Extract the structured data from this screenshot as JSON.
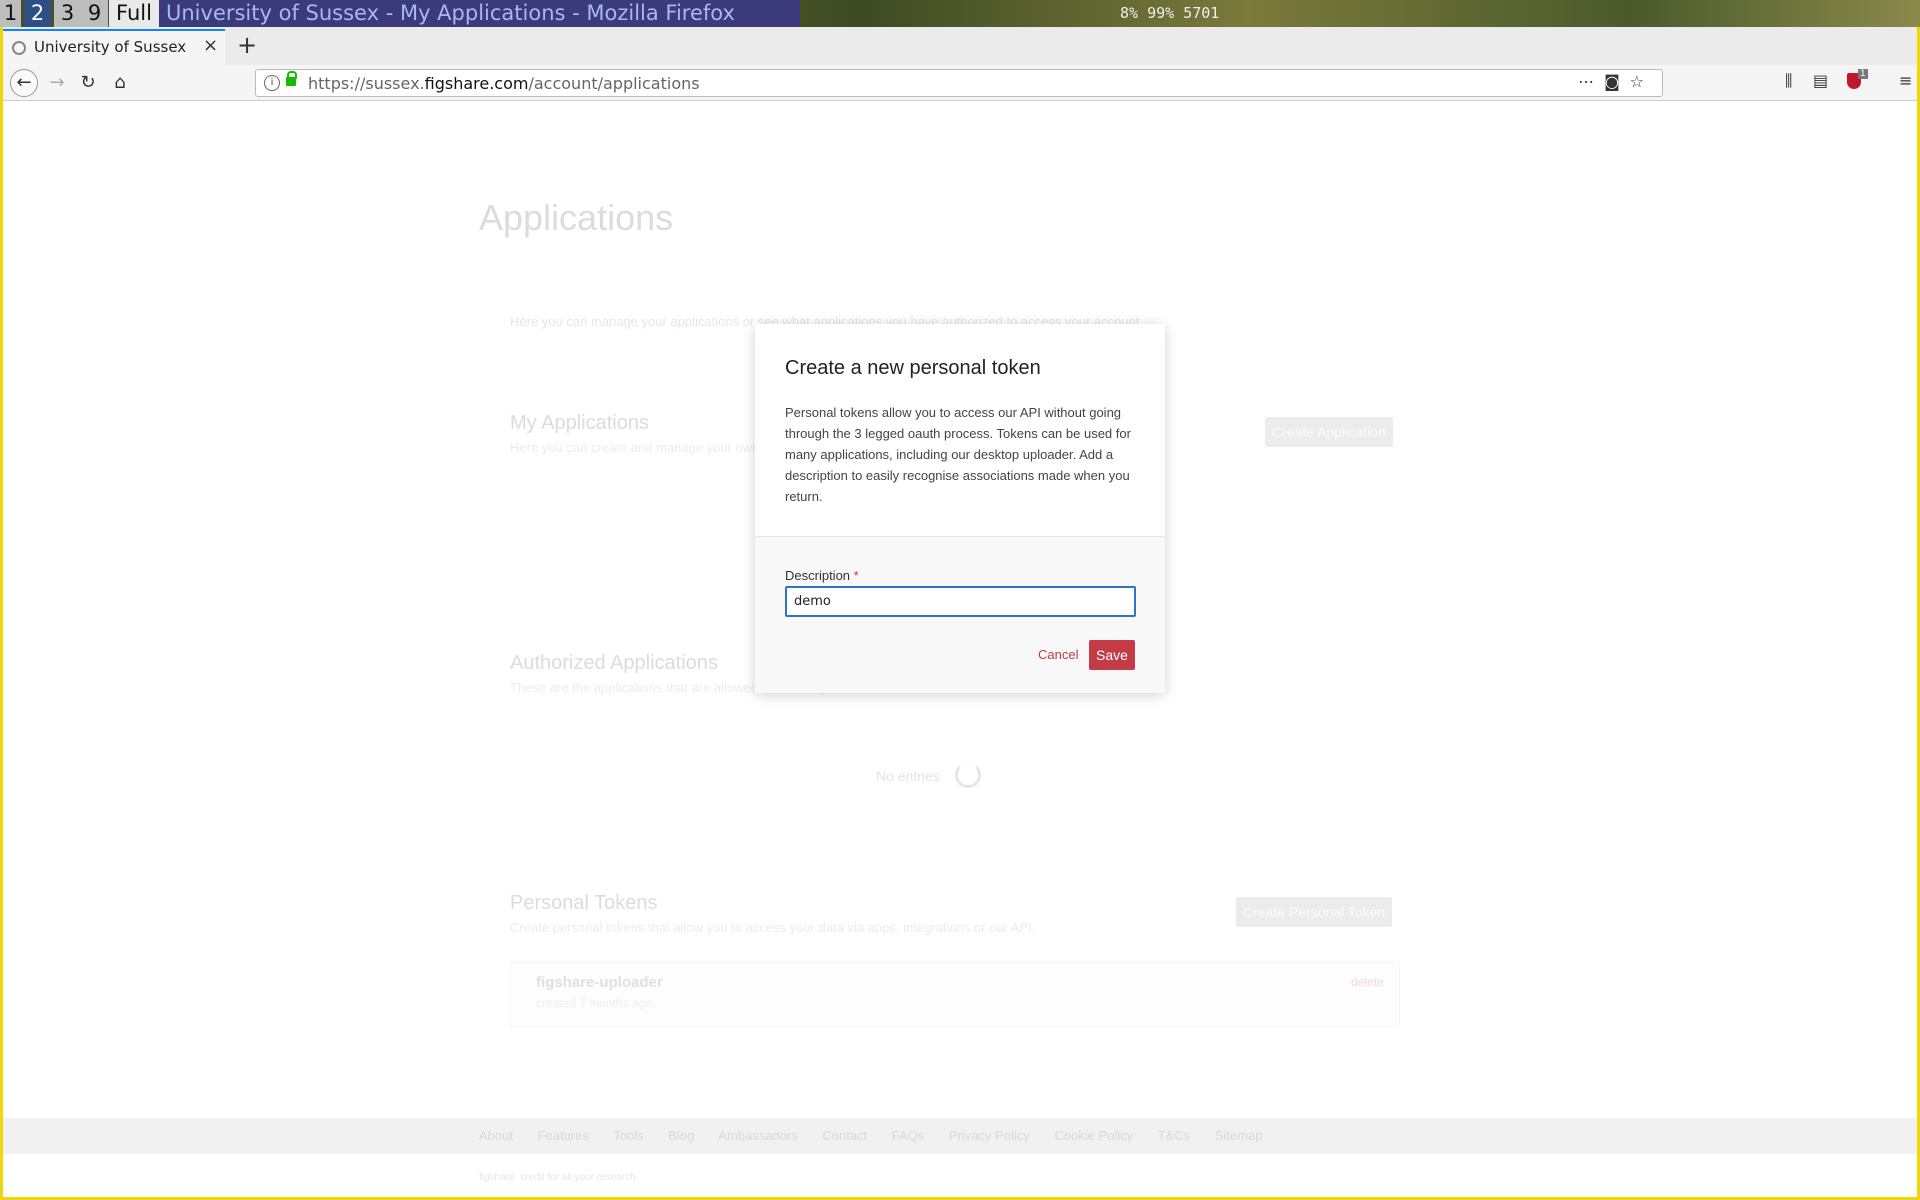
{
  "wm": {
    "workspaces": [
      "1",
      "2",
      "3",
      "9",
      "Full"
    ],
    "window_title": "University of Sussex - My Applications - Mozilla Firefox",
    "stats": "8% 99% 5701"
  },
  "browser": {
    "tab_title": "University of Sussex - My Applications",
    "new_tab": "+",
    "url_prefix": "https://sussex.",
    "url_domain": "figshare.com",
    "url_path": "/account/applications",
    "ublock_count": "1"
  },
  "page": {
    "title": "Applications",
    "intro": "Here you can manage your applications or see what applications you have authorized to access your account.",
    "my_apps": {
      "title": "My Applications",
      "subtitle": "Here you can create and manage your own applications.",
      "button": "Create Application"
    },
    "authorized": {
      "title": "Authorized Applications",
      "subtitle": "These are the applications that are allowed to access your account.",
      "empty": "No entries"
    },
    "tokens": {
      "title": "Personal Tokens",
      "subtitle": "Create personal tokens that allow you to access your data via apps, integrations or our API.",
      "button": "Create Personal Token",
      "items": [
        {
          "name": "figshare-uploader",
          "meta": "created 7 months ago.",
          "delete": "delete"
        }
      ]
    },
    "footer": {
      "links": [
        "About",
        "Features",
        "Tools",
        "Blog",
        "Ambassadors",
        "Contact",
        "FAQs",
        "Privacy Policy",
        "Cookie Policy",
        "T&Cs",
        "Sitemap"
      ],
      "tagline": "figshare. credit for all your research."
    }
  },
  "modal": {
    "title": "Create a new personal token",
    "description": "Personal tokens allow you to access our API without going through the 3 legged oauth process. Tokens can be used for many applications, including our desktop uploader. Add a description to easily recognise associations made when you return.",
    "field_label": "Description",
    "required_mark": "*",
    "field_value": "demo",
    "cancel": "Cancel",
    "save": "Save"
  },
  "colors": {
    "accent": "#c23b46",
    "focus": "#2e73c9",
    "frame": "#f0d60c"
  }
}
